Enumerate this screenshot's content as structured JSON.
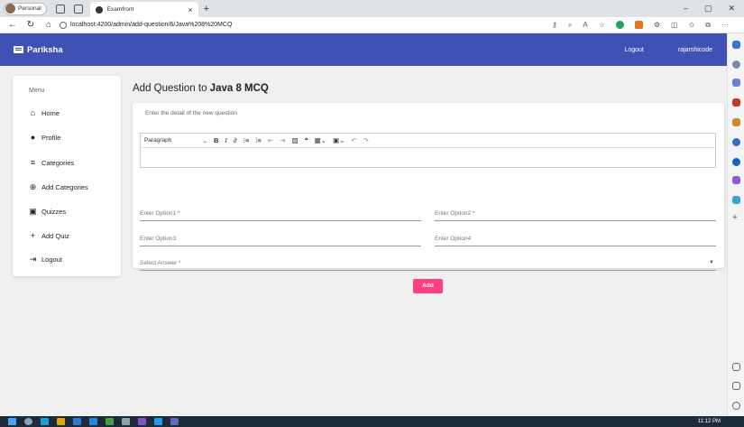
{
  "browser": {
    "profile_label": "Personal",
    "tab_title": "Examfront",
    "url": "localhost:4200/admin/add-question/6/Java%208%20MCQ"
  },
  "navbar": {
    "brand": "Pariksha",
    "logout": "Logout",
    "username": "rajarshicode"
  },
  "sidebar": {
    "heading": "Menu",
    "items": [
      {
        "label": "Home",
        "icon": "home-icon"
      },
      {
        "label": "Profile",
        "icon": "account-icon"
      },
      {
        "label": "Categories",
        "icon": "list-icon"
      },
      {
        "label": "Add Categories",
        "icon": "add-circle-icon"
      },
      {
        "label": "Quizzes",
        "icon": "quiz-icon"
      },
      {
        "label": "Add Quiz",
        "icon": "plus-icon"
      },
      {
        "label": "Logout",
        "icon": "logout-icon"
      }
    ]
  },
  "main": {
    "title_prefix": "Add Question to ",
    "quiz_name": "Java 8 MCQ",
    "subtitle": "Enter the detail of the new question"
  },
  "editor": {
    "paragraph_label": "Paragraph"
  },
  "form": {
    "option1": "Enter Option1 *",
    "option2": "Enter Option2 *",
    "option3": "Enter Option3",
    "option4": "Enter Option4",
    "answer": "Select Answer *",
    "submit": "Add"
  },
  "taskbar": {
    "time": "11:12 PM"
  },
  "colors": {
    "primary": "#3f51b5",
    "accent": "#ff4081"
  }
}
